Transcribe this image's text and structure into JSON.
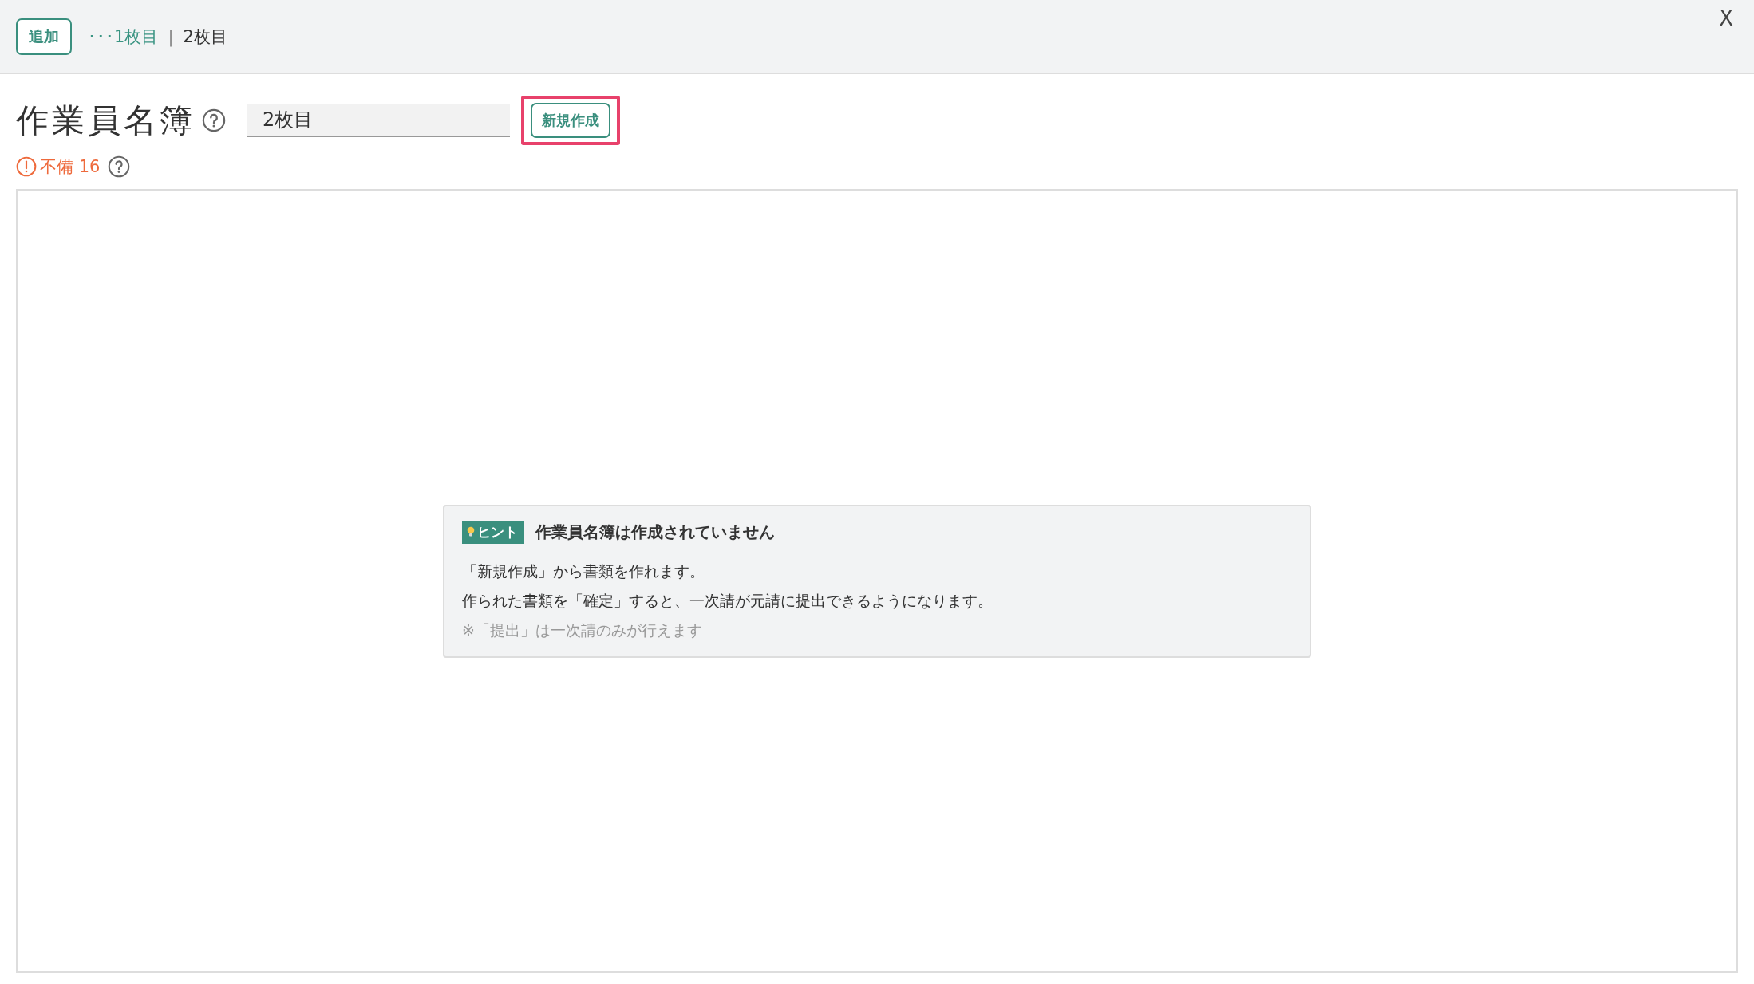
{
  "header": {
    "add_button": "追加",
    "breadcrumb": [
      {
        "label": "･･･1枚目",
        "selected": false
      },
      {
        "label": "2枚目",
        "selected": true
      }
    ],
    "separator": "|",
    "close": "X"
  },
  "title": "作業員名簿",
  "sheet_name": {
    "value": "2枚目"
  },
  "create_button": {
    "label": "新規作成",
    "highlighted": true
  },
  "warning": {
    "label": "不備 16"
  },
  "hint": {
    "badge": "ヒント",
    "heading": "作業員名簿は作成されていません",
    "lines": [
      {
        "text": "「新規作成」から書類を作れます。",
        "kind": "normal"
      },
      {
        "text": "作られた書類を「確定」すると、一次請が元請に提出できるようになります。",
        "kind": "normal"
      },
      {
        "text": "※「提出」は一次請のみが行えます",
        "kind": "note"
      }
    ]
  }
}
